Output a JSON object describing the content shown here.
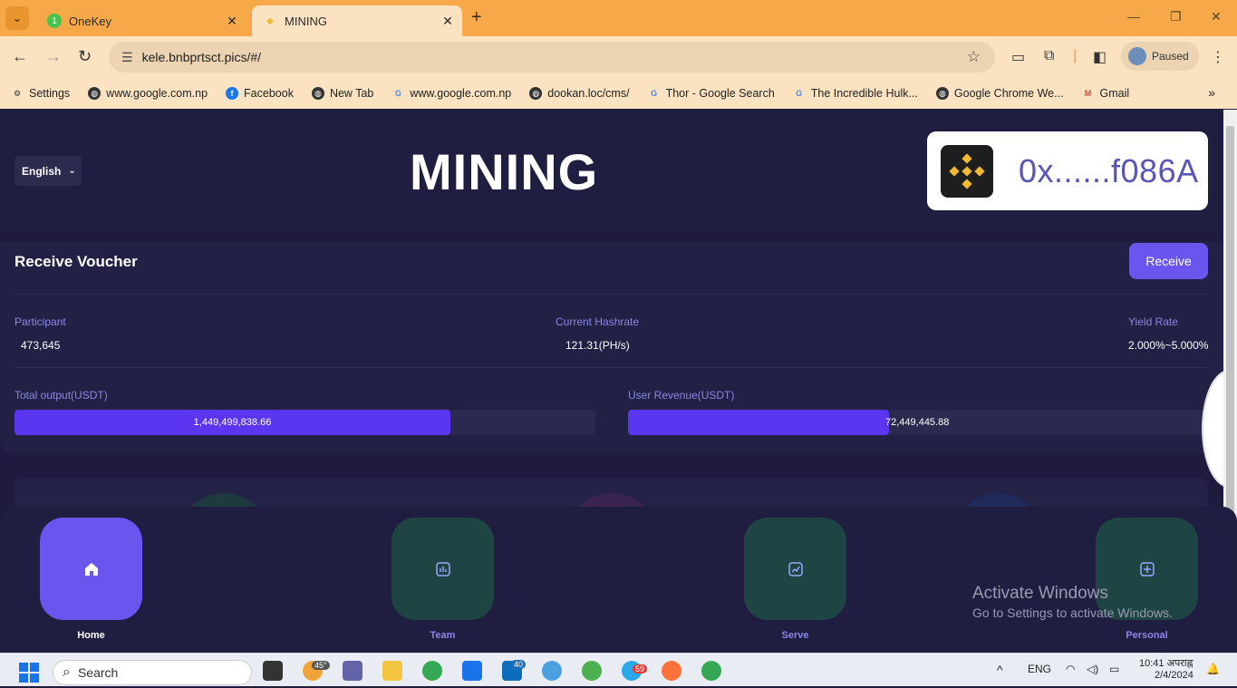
{
  "browser": {
    "tabs": [
      {
        "title": "OneKey",
        "active": false
      },
      {
        "title": "MINING",
        "active": true
      }
    ],
    "url": "kele.bnbprtsct.pics/#/",
    "profile_label": "Paused",
    "bookmarks": [
      {
        "label": "Settings",
        "icon": "gear-icon"
      },
      {
        "label": "www.google.com.np",
        "icon": "globe-icon"
      },
      {
        "label": "Facebook",
        "icon": "facebook-icon"
      },
      {
        "label": "New Tab",
        "icon": "globe-icon"
      },
      {
        "label": "www.google.com.np",
        "icon": "google-icon"
      },
      {
        "label": "dookan.loc/cms/",
        "icon": "globe-icon"
      },
      {
        "label": "Thor - Google Search",
        "icon": "google-icon"
      },
      {
        "label": "The Incredible Hulk...",
        "icon": "google-icon"
      },
      {
        "label": "Google Chrome We...",
        "icon": "globe-icon"
      },
      {
        "label": "Gmail",
        "icon": "gmail-icon"
      }
    ]
  },
  "header": {
    "language": "English",
    "title": "MINING",
    "wallet_address": "0x......f086A"
  },
  "voucher": {
    "title": "Receive Voucher",
    "receive_label": "Receive",
    "stats": [
      {
        "label": "Participant",
        "value": "473,645"
      },
      {
        "label": "Current Hashrate",
        "value": "121.31(PH/s)"
      },
      {
        "label": "Yield Rate",
        "value": "2.000%~5.000%"
      }
    ],
    "total_output": {
      "label": "Total output(USDT)",
      "value": "1,449,499,838.66",
      "progress": 0.75
    },
    "user_revenue": {
      "label": "User Revenue(USDT)",
      "value": "72,449,445.88",
      "progress": 0.45
    }
  },
  "nav": [
    {
      "label": "Home",
      "icon": "home-icon",
      "active": true
    },
    {
      "label": "Team",
      "icon": "chart-icon",
      "active": false
    },
    {
      "label": "Serve",
      "icon": "trend-icon",
      "active": false
    },
    {
      "label": "Personal",
      "icon": "plus-square-icon",
      "active": false
    }
  ],
  "watermark": {
    "line1": "Activate Windows",
    "line2": "Go to Settings to activate Windows."
  },
  "taskbar": {
    "search_placeholder": "Search",
    "weather": "45°",
    "mail_badge": "40",
    "telegram_badge": "59",
    "lang": "ENG",
    "time": "10:41 अपराह्न",
    "date": "2/4/2024"
  },
  "colors": {
    "accent": "#6a56ef",
    "page_bg": "#1e1b3e",
    "tab_bar": "#f7a94a"
  }
}
